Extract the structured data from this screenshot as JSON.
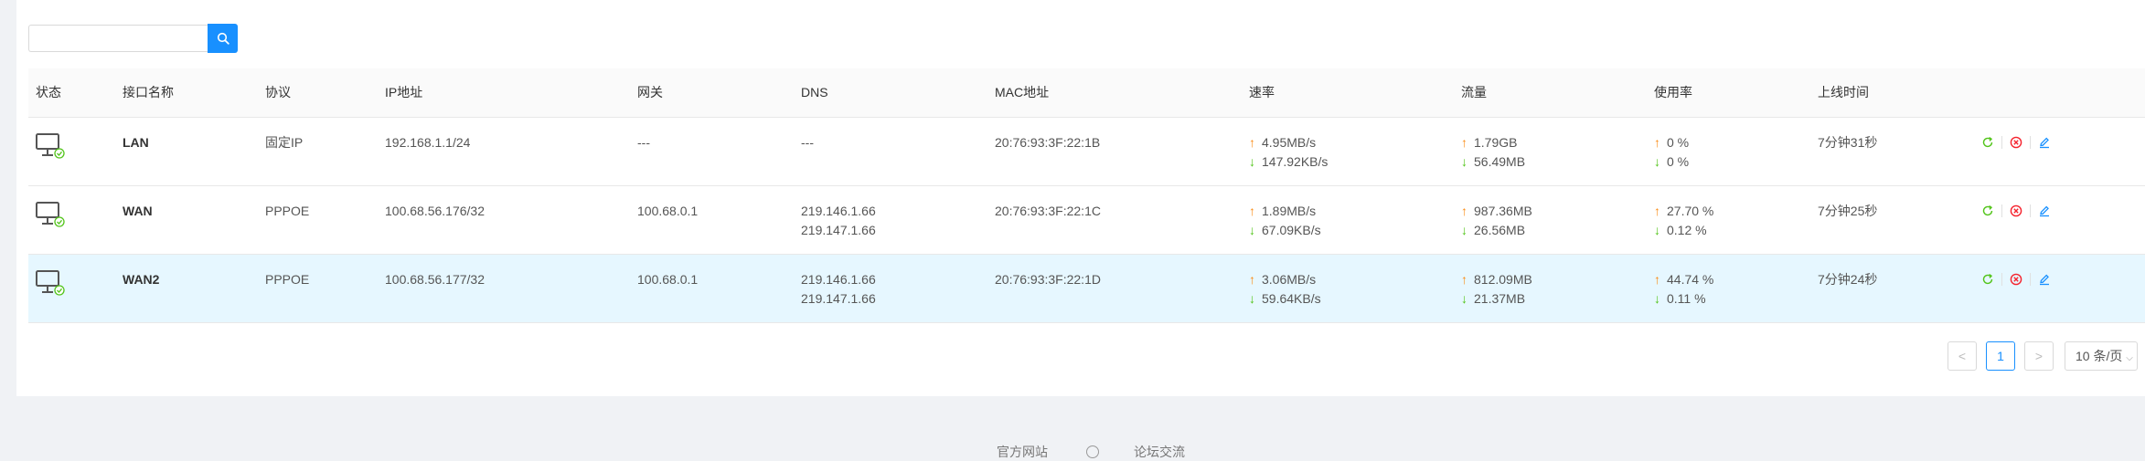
{
  "search": {
    "placeholder": "",
    "value": ""
  },
  "table": {
    "headers": [
      "状态",
      "接口名称",
      "协议",
      "IP地址",
      "网关",
      "DNS",
      "MAC地址",
      "速率",
      "流量",
      "使用率",
      "上线时间"
    ],
    "rows": [
      {
        "name": "LAN",
        "protocol": "固定IP",
        "ip": "192.168.1.1/24",
        "gateway": "---",
        "dns1": "---",
        "dns2": "",
        "mac": "20:76:93:3F:22:1B",
        "rate_up": "4.95MB/s",
        "rate_down": "147.92KB/s",
        "traffic_up": "1.79GB",
        "traffic_down": "56.49MB",
        "usage_up": "0 %",
        "usage_down": "0 %",
        "uptime": "7分钟31秒"
      },
      {
        "name": "WAN",
        "protocol": "PPPOE",
        "ip": "100.68.56.176/32",
        "gateway": "100.68.0.1",
        "dns1": "219.146.1.66",
        "dns2": "219.147.1.66",
        "mac": "20:76:93:3F:22:1C",
        "rate_up": "1.89MB/s",
        "rate_down": "67.09KB/s",
        "traffic_up": "987.36MB",
        "traffic_down": "26.56MB",
        "usage_up": "27.70 %",
        "usage_down": "0.12 %",
        "uptime": "7分钟25秒"
      },
      {
        "name": "WAN2",
        "protocol": "PPPOE",
        "ip": "100.68.56.177/32",
        "gateway": "100.68.0.1",
        "dns1": "219.146.1.66",
        "dns2": "219.147.1.66",
        "mac": "20:76:93:3F:22:1D",
        "rate_up": "3.06MB/s",
        "rate_down": "59.64KB/s",
        "traffic_up": "812.09MB",
        "traffic_down": "21.37MB",
        "usage_up": "44.74 %",
        "usage_down": "0.11 %",
        "uptime": "7分钟24秒"
      }
    ]
  },
  "pagination": {
    "prev": "<",
    "current": "1",
    "next": ">",
    "page_size": "10 条/页"
  },
  "footer": {
    "link1": "官方网站",
    "link2": "论坛交流"
  },
  "colors": {
    "primary": "#1890ff",
    "up": "#fa8c16",
    "down": "#52c41a",
    "danger": "#f5222d",
    "highlight_row": "#e6f7ff"
  },
  "icons": {
    "search": "search-icon",
    "status": "monitor-connected-icon",
    "restart": "refresh-icon",
    "disconnect": "close-circle-icon",
    "edit": "edit-icon"
  }
}
